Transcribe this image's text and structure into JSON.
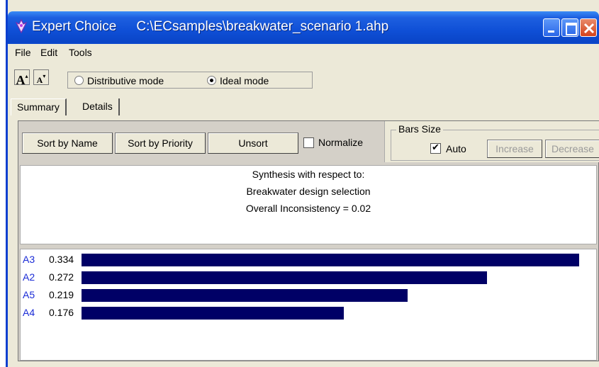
{
  "window": {
    "app_name": "Expert Choice",
    "file_path": "C:\\ECsamples\\breakwater_scenario 1.ahp"
  },
  "menu": {
    "items": [
      "File",
      "Edit",
      "Tools"
    ]
  },
  "toolbar": {
    "font_increase": "A",
    "font_decrease": "A",
    "modes": [
      {
        "label": "Distributive mode",
        "selected": false
      },
      {
        "label": "Ideal mode",
        "selected": true
      }
    ]
  },
  "tabs": [
    {
      "label": "Summary",
      "active": true
    },
    {
      "label": "Details",
      "active": false
    }
  ],
  "sort_panel": {
    "sort_by_name": "Sort by Name",
    "sort_by_priority": "Sort by Priority",
    "unsort": "Unsort",
    "normalize_label": "Normalize",
    "normalize_checked": false
  },
  "bars_size": {
    "legend": "Bars Size",
    "auto_label": "Auto",
    "auto_checked": true,
    "increase": "Increase",
    "decrease": "Decrease"
  },
  "synthesis": {
    "line1": "Synthesis with respect to:",
    "line2": "Breakwater design selection",
    "inconsistency_label": "Overall Inconsistency =",
    "inconsistency_value": "0.02"
  },
  "alternatives": [
    {
      "name": "A3",
      "value": "0.334",
      "priority": 0.334
    },
    {
      "name": "A2",
      "value": "0.272",
      "priority": 0.272
    },
    {
      "name": "A5",
      "value": "0.219",
      "priority": 0.219
    },
    {
      "name": "A4",
      "value": "0.176",
      "priority": 0.176
    }
  ],
  "colors": {
    "bar": "#000066",
    "alternative_label": "#1a2bd6",
    "titlebar": "#0f4fd6"
  }
}
